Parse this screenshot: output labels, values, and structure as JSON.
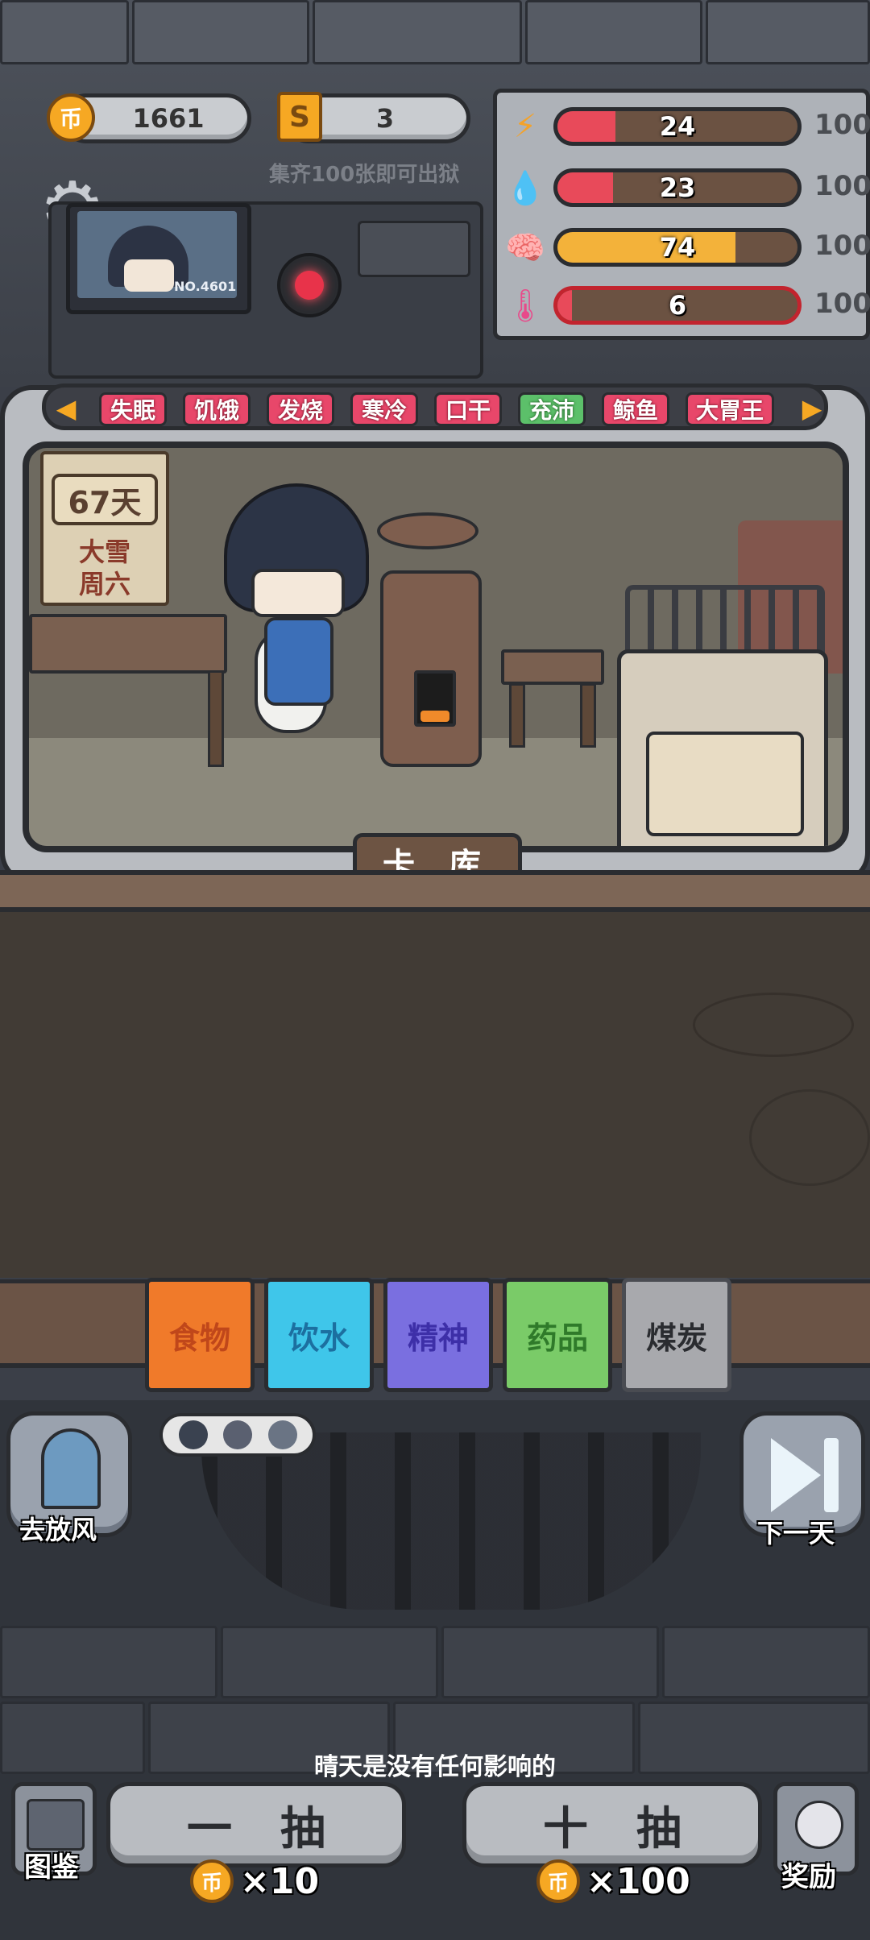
{
  "resources": {
    "coins": "1661",
    "coin_glyph": "币",
    "shards": "3",
    "shard_glyph": "S",
    "shard_hint": "集齐100张即可出狱"
  },
  "stats": [
    {
      "icon": "energy-icon",
      "glyph": "⚡",
      "value": "24",
      "max": "100",
      "level": 0.24,
      "color": "#e84a5a"
    },
    {
      "icon": "water-drop-icon",
      "glyph": "💧",
      "value": "23",
      "max": "100",
      "level": 0.23,
      "color": "#e84a5a"
    },
    {
      "icon": "brain-icon",
      "glyph": "🧠",
      "value": "74",
      "max": "100",
      "level": 0.74,
      "color": "#f3b23a"
    },
    {
      "icon": "thermometer-icon",
      "glyph": "🌡",
      "value": "6",
      "max": "100",
      "level": 0.06,
      "color": "#e84a5a"
    }
  ],
  "monitor": {
    "id_label": "NO.4601"
  },
  "status_tags": [
    {
      "label": "失眠",
      "color": "#e8476a"
    },
    {
      "label": "饥饿",
      "color": "#e8476a"
    },
    {
      "label": "发烧",
      "color": "#e8476a"
    },
    {
      "label": "寒冷",
      "color": "#e8476a"
    },
    {
      "label": "口干",
      "color": "#e8476a"
    },
    {
      "label": "充沛",
      "color": "#5cc06a"
    },
    {
      "label": "鲸鱼",
      "color": "#e8476a"
    },
    {
      "label": "大胃王",
      "color": "#e8476a"
    }
  ],
  "calendar": {
    "days": "67天",
    "weather": "大雪",
    "weekday": "周六"
  },
  "card_library_label": "卡 库",
  "categories": [
    {
      "label": "食物",
      "color": "#f07a2a",
      "text_color": "#c0471a"
    },
    {
      "label": "饮水",
      "color": "#3fc6ea",
      "text_color": "#1c6fa0"
    },
    {
      "label": "精神",
      "color": "#7a6fe0",
      "text_color": "#3d2fa8"
    },
    {
      "label": "药品",
      "color": "#7acb68",
      "text_color": "#2f7a2a"
    },
    {
      "label": "煤炭",
      "color": "#a8a9ad",
      "text_color": "#2a2c30"
    }
  ],
  "actions": {
    "go_out": "去放风",
    "next_day": "下一天",
    "handbook": "图鉴",
    "reward": "奖励"
  },
  "weather_hint": "晴天是没有任何影响的",
  "draw": {
    "single_label": "一抽",
    "single_cost": "×10",
    "ten_label": "十抽",
    "ten_cost": "×100"
  }
}
